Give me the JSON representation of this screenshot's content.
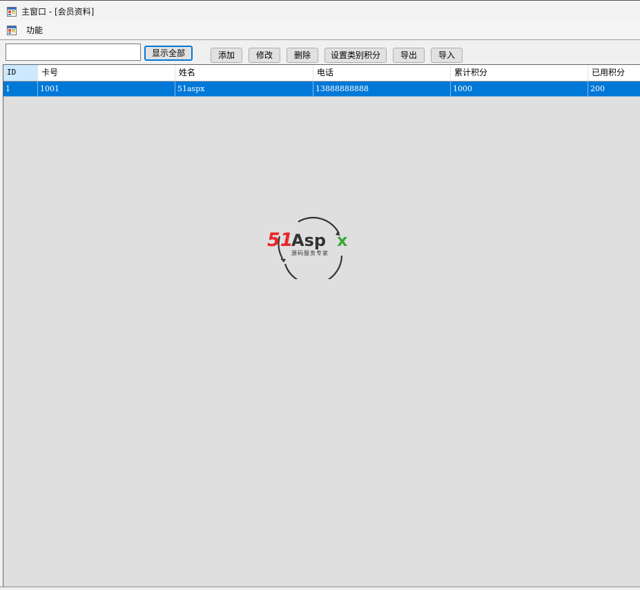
{
  "window": {
    "title": "主窗口 - [会员资料]"
  },
  "menu": {
    "items": [
      "功能"
    ]
  },
  "toolbar": {
    "search_value": "",
    "show_all_label": "显示全部",
    "buttons": [
      "添加",
      "修改",
      "删除",
      "设置类别积分",
      "导出",
      "导入"
    ]
  },
  "grid": {
    "columns": [
      "ID",
      "卡号",
      "姓名",
      "电话",
      "累计积分",
      "已用积分"
    ],
    "rows": [
      [
        "1",
        "1001",
        "51aspx",
        "13888888888",
        "1000",
        "200"
      ]
    ],
    "selected_row": 0
  },
  "watermark": {
    "brand_red": "51",
    "brand_dark": "Asp",
    "brand_green": "x",
    "tagline": "源码服务专家"
  },
  "colors": {
    "selection": "#0078d7",
    "header_selected": "#cce8ff",
    "grid_background": "#dfdfdf",
    "logo_red": "#e8262a",
    "logo_green": "#3aa935"
  },
  "icons": {
    "app": "window-form-icon",
    "menu": "window-form-icon"
  }
}
